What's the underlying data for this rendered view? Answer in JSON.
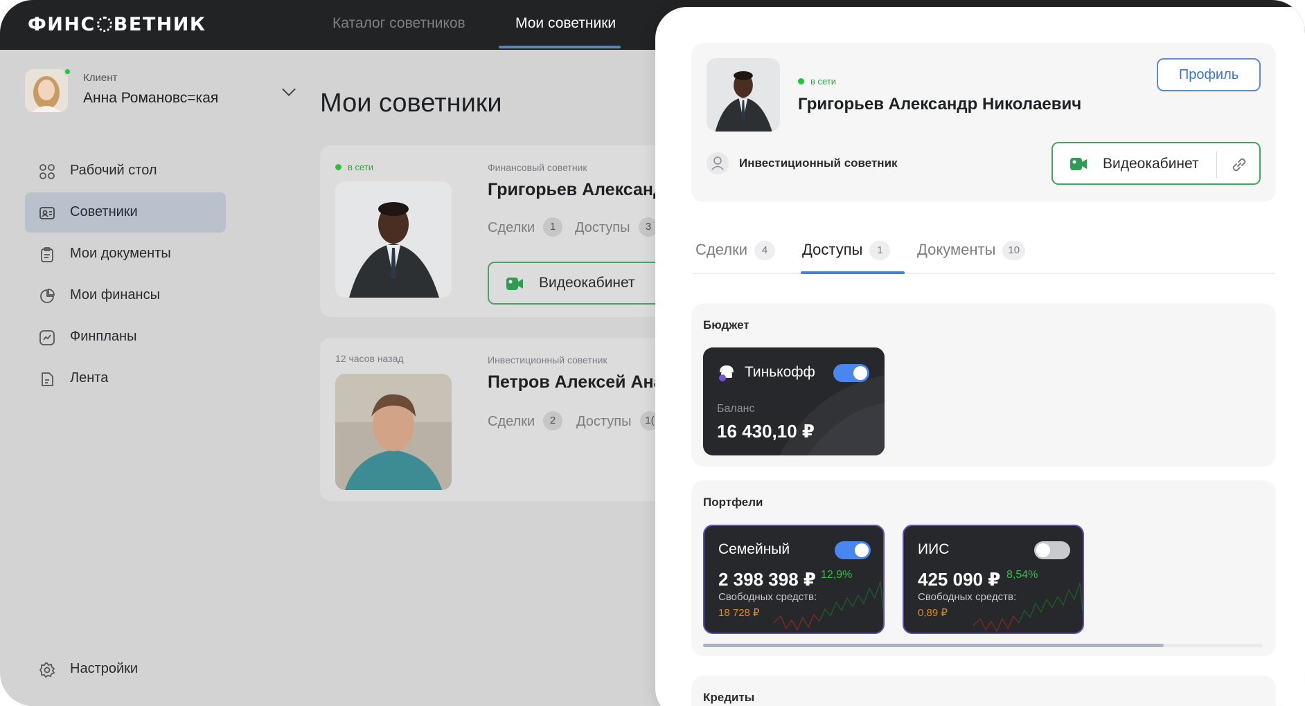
{
  "app": {
    "logo": "ФИНСОВЕТНИК",
    "nav_tabs": [
      {
        "label": "Каталог советников"
      },
      {
        "label": "Мои советники"
      }
    ]
  },
  "user": {
    "role": "Клиент",
    "name": "Анна Романовс=кая"
  },
  "sidebar": {
    "items": [
      {
        "label": "Рабочий стол",
        "icon": "dashboard-icon"
      },
      {
        "label": "Советники",
        "icon": "contact-card-icon"
      },
      {
        "label": "Мои документы",
        "icon": "clipboard-icon"
      },
      {
        "label": "Мои финансы",
        "icon": "pie-chart-icon"
      },
      {
        "label": "Финпланы",
        "icon": "trend-icon"
      },
      {
        "label": "Лента",
        "icon": "feed-icon"
      }
    ],
    "settings_label": "Настройки"
  },
  "main": {
    "title": "Мои советники",
    "advisors": [
      {
        "status": "в сети",
        "role": "Финансовый советник",
        "name": "Григорьев Александ",
        "deals_label": "Сделки",
        "deals_count": "1",
        "access_label": "Доступы",
        "access_count": "3",
        "video_label": "Видеокабинет"
      },
      {
        "status": "12 часов назад",
        "role": "Инвестиционный советник",
        "name": "Петров Алексей Ана",
        "deals_label": "Сделки",
        "deals_count": "2",
        "access_label": "Доступы",
        "access_count": "1("
      }
    ]
  },
  "drawer": {
    "status": "в сети",
    "name": "Григорьев Александр Николаевич",
    "profile_button": "Профиль",
    "role": "Инвестиционный советник",
    "video_button": "Видеокабинет",
    "tabs": [
      {
        "label": "Сделки",
        "count": "4"
      },
      {
        "label": "Доступы",
        "count": "1"
      },
      {
        "label": "Документы",
        "count": "10"
      }
    ],
    "budget": {
      "title": "Бюджет",
      "bank": "Тинькофф",
      "balance_label": "Баланс",
      "balance": "16 430,10 ₽",
      "enabled": true
    },
    "portfolios": {
      "title": "Портфели",
      "items": [
        {
          "name": "Семейный",
          "amount": "2 398 398 ₽",
          "pct": "12,9%",
          "free_label": "Свободных средств:",
          "free": "18 728 ₽",
          "enabled": true
        },
        {
          "name": "ИИС",
          "amount": "425 090 ₽",
          "pct": "8,54%",
          "free_label": "Свободных средств:",
          "free": "0,89 ₽",
          "enabled": false
        }
      ]
    },
    "credits": {
      "title": "Кредиты"
    }
  },
  "colors": {
    "topbar": "#222325",
    "accent_blue": "#4a86f0",
    "online_green": "#27c33b",
    "video_green": "#3fa85b",
    "card_dark": "#27282b",
    "gain_green": "#31c145",
    "free_orange": "#e08c1c"
  }
}
